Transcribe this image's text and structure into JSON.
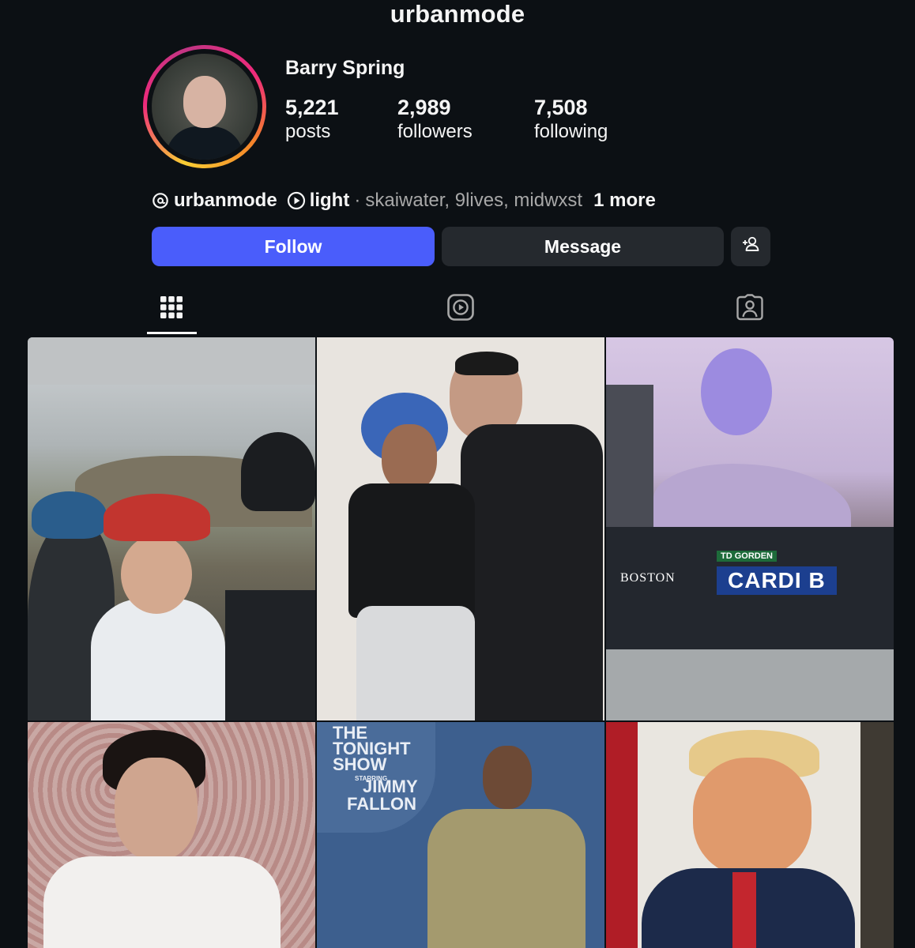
{
  "header": {
    "username": "urbanmode"
  },
  "profile": {
    "display_name": "Barry Spring",
    "stats": [
      {
        "number": "5,221",
        "label": "posts"
      },
      {
        "number": "2,989",
        "label": "followers"
      },
      {
        "number": "7,508",
        "label": "following"
      }
    ],
    "threads_icon": "threads-icon",
    "threads_handle": "urbanmode",
    "play_icon": "play-circle-icon",
    "link_label": "light",
    "separator": "·",
    "mutuals": "skaiwater, 9lives, midwxst",
    "more_label": "1 more"
  },
  "actions": {
    "follow_label": "Follow",
    "message_label": "Message",
    "add_user_icon": "add-person-icon"
  },
  "tabs": [
    {
      "icon": "grid-icon",
      "active": true
    },
    {
      "icon": "reels-icon",
      "active": false
    },
    {
      "icon": "tagged-icon",
      "active": false
    }
  ],
  "posts": [
    {
      "kind": "photo"
    },
    {
      "kind": "photo"
    },
    {
      "kind": "photo",
      "overlay": [
        "TD GORDEN",
        "BOSTON",
        "CARDI B"
      ]
    },
    {
      "kind": "photo"
    },
    {
      "kind": "photo",
      "overlay": [
        "THE",
        "TONIGHT",
        "SHOW",
        "STARRING",
        "JIMMY",
        "FALLON"
      ]
    },
    {
      "kind": "photo"
    }
  ],
  "colors": {
    "background": "#0c1014",
    "follow_button": "#4a5dfb",
    "secondary_button": "#25292e",
    "muted_text": "#a8a8a8"
  }
}
